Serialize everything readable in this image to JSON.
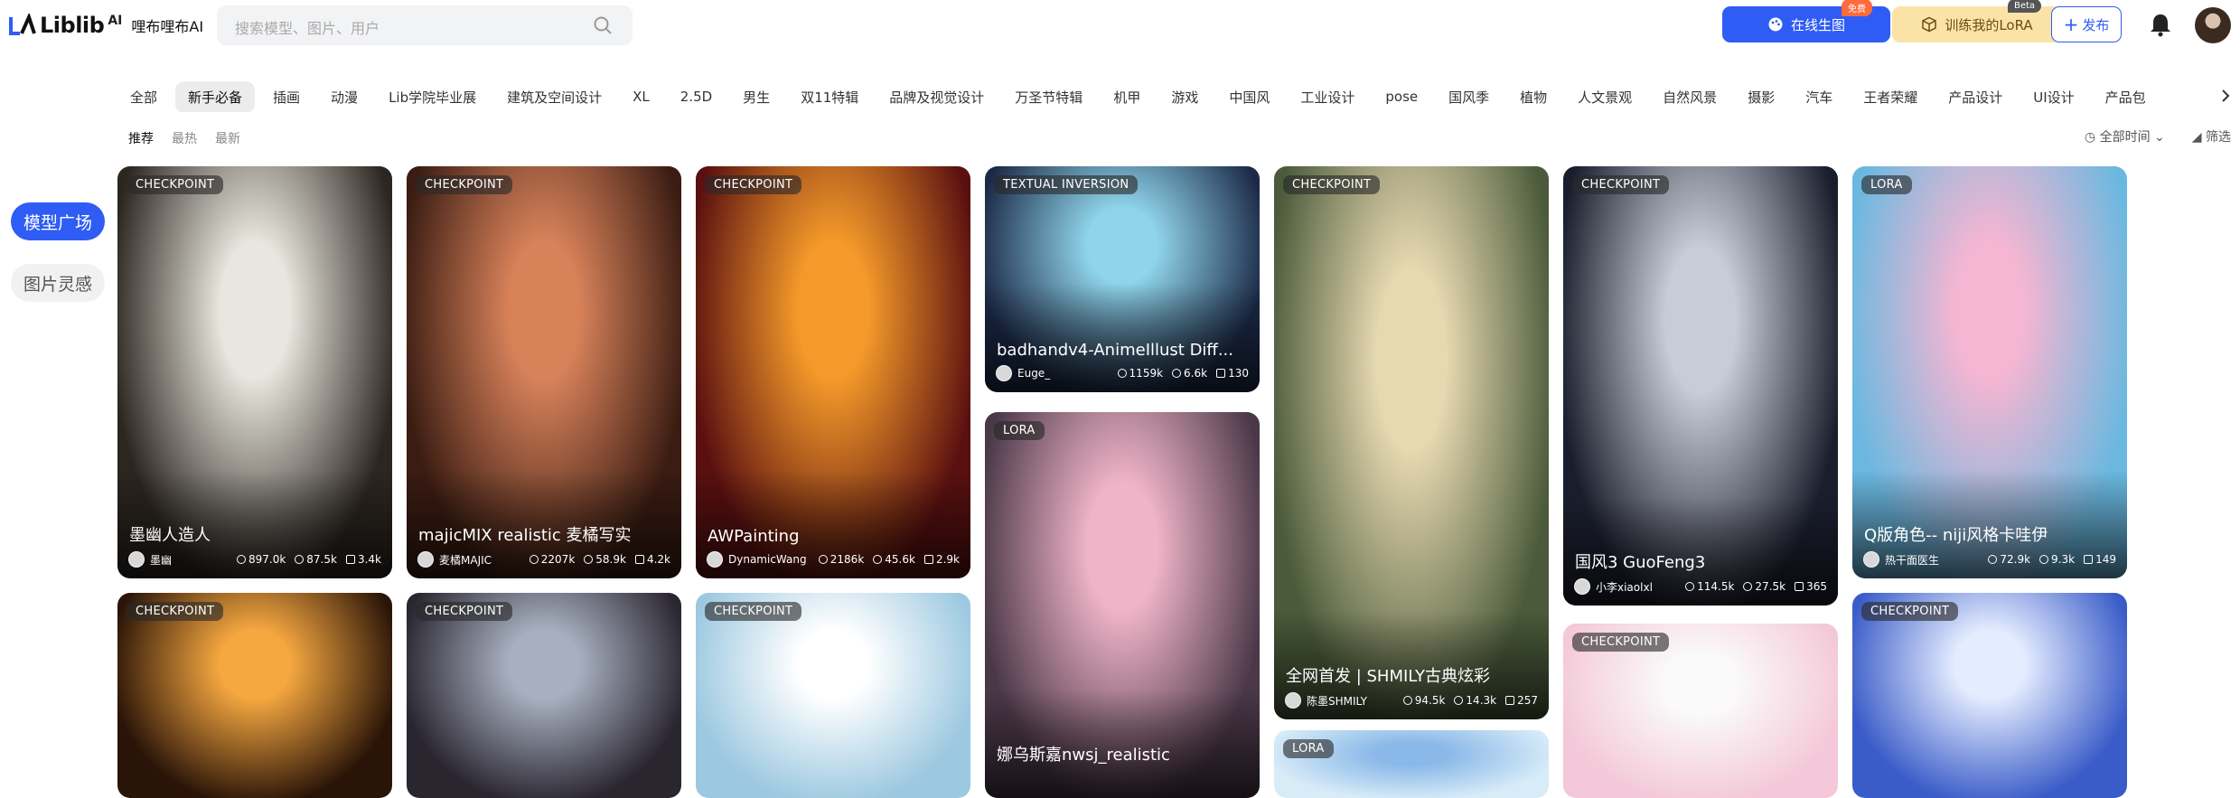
{
  "header": {
    "logo_text": "Liblib",
    "logo_ai": "AI",
    "logo_cn": "哩布哩布AI",
    "search_placeholder": "搜索模型、图片、用户",
    "gen_label": "在线生图",
    "gen_badge": "免费",
    "lora_label": "训练我的LoRA",
    "lora_badge": "Beta",
    "publish_label": "发布"
  },
  "categories": [
    "全部",
    "新手必备",
    "插画",
    "动漫",
    "Lib学院毕业展",
    "建筑及空间设计",
    "XL",
    "2.5D",
    "男生",
    "双11特辑",
    "品牌及视觉设计",
    "万圣节特辑",
    "机甲",
    "游戏",
    "中国风",
    "工业设计",
    "pose",
    "国风季",
    "植物",
    "人文景观",
    "自然风景",
    "摄影",
    "汽车",
    "王者荣耀",
    "产品设计",
    "UI设计",
    "产品包"
  ],
  "active_category": 1,
  "sorts": [
    "推荐",
    "最热",
    "最新"
  ],
  "filters": {
    "time": "全部时间",
    "filter": "筛选"
  },
  "sidebar": [
    "模型广场",
    "图片灵感"
  ],
  "cards": [
    {
      "tag": "CHECKPOINT",
      "title": "墨幽人造人",
      "author": "墨幽",
      "runs": "897.0k",
      "downloads": "87.5k",
      "images": "3.4k",
      "colors": [
        "#e8e6de",
        "#2c2620"
      ]
    },
    {
      "tag": "CHECKPOINT",
      "title": "majicMIX realistic 麦橘写实",
      "author": "麦橘MAJIC",
      "runs": "2207k",
      "downloads": "58.9k",
      "images": "4.2k",
      "colors": [
        "#d8825a",
        "#3a1c12"
      ]
    },
    {
      "tag": "CHECKPOINT",
      "title": "AWPainting",
      "author": "DynamicWang",
      "runs": "2186k",
      "downloads": "45.6k",
      "images": "2.9k",
      "colors": [
        "#f59a2a",
        "#5a1010"
      ]
    },
    {
      "tag": "TEXTUAL INVERSION",
      "title": "badhandv4-AnimeIllust Diff...",
      "author": "Euge_",
      "runs": "1159k",
      "downloads": "6.6k",
      "images": "130",
      "colors": [
        "#8fd4ea",
        "#1c2a48"
      ]
    },
    {
      "tag": "LORA",
      "title": "娜乌斯嘉nwsj_realistic",
      "author": "",
      "runs": "",
      "downloads": "",
      "images": "",
      "colors": [
        "#f0b4c8",
        "#4a3848"
      ]
    },
    {
      "tag": "CHECKPOINT",
      "title": "全网首发 | SHMILY古典炫彩",
      "author": "陈墨SHMILY",
      "runs": "94.5k",
      "downloads": "14.3k",
      "images": "257",
      "colors": [
        "#e6d8b0",
        "#4a5a3a"
      ]
    },
    {
      "tag": "LORA",
      "title": "",
      "author": "",
      "runs": "",
      "downloads": "",
      "images": "",
      "colors": [
        "#8ab8e8",
        "#d8ecf8"
      ]
    },
    {
      "tag": "CHECKPOINT",
      "title": "国风3 GuoFeng3",
      "author": "小李xiaolxl",
      "runs": "114.5k",
      "downloads": "27.5k",
      "images": "365",
      "colors": [
        "#c8ccd6",
        "#1a1e2c"
      ]
    },
    {
      "tag": "CHECKPOINT",
      "title": "",
      "author": "",
      "runs": "",
      "downloads": "",
      "images": "",
      "colors": [
        "#fafafa",
        "#f4c8d8"
      ]
    },
    {
      "tag": "LORA",
      "title": "Q版角色-- niji风格卡哇伊",
      "author": "热干面医生",
      "runs": "72.9k",
      "downloads": "9.3k",
      "images": "149",
      "colors": [
        "#f4b6d2",
        "#6ab8e0"
      ]
    },
    {
      "tag": "CHECKPOINT",
      "title": "",
      "author": "",
      "runs": "",
      "downloads": "",
      "images": "",
      "colors": [
        "#f6a840",
        "#2a1408"
      ]
    },
    {
      "tag": "CHECKPOINT",
      "title": "",
      "author": "",
      "runs": "",
      "downloads": "",
      "images": "",
      "colors": [
        "#a8b0c0",
        "#2a2630"
      ]
    },
    {
      "tag": "CHECKPOINT",
      "title": "",
      "author": "",
      "runs": "",
      "downloads": "",
      "images": "",
      "colors": [
        "#ffffff",
        "#9cc8e0"
      ]
    },
    {
      "tag": "CHECKPOINT",
      "title": "",
      "author": "",
      "runs": "",
      "downloads": "",
      "images": "",
      "colors": [
        "#e4ecff",
        "#3a5cc8"
      ]
    }
  ]
}
